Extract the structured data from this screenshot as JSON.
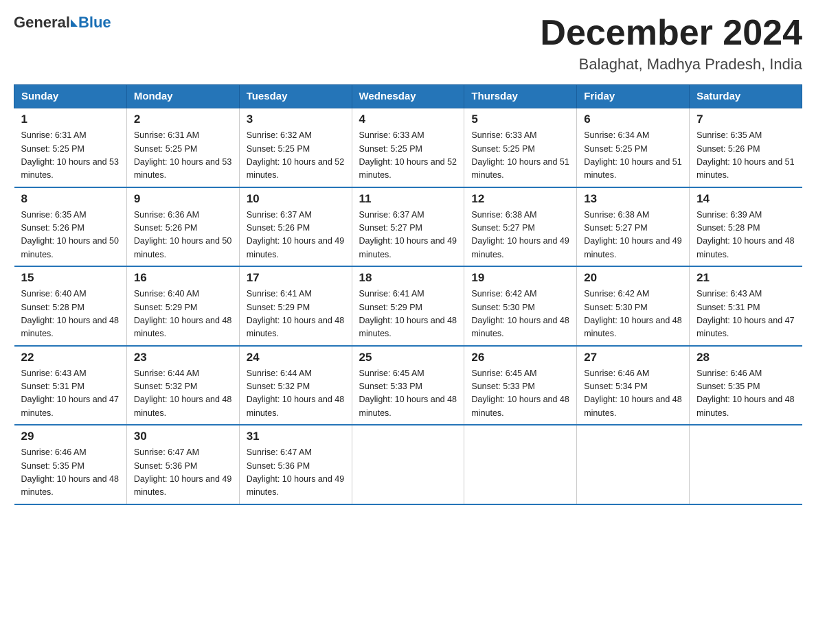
{
  "header": {
    "logo_general": "General",
    "logo_blue": "Blue",
    "month_title": "December 2024",
    "location": "Balaghat, Madhya Pradesh, India"
  },
  "days_of_week": [
    "Sunday",
    "Monday",
    "Tuesday",
    "Wednesday",
    "Thursday",
    "Friday",
    "Saturday"
  ],
  "weeks": [
    [
      {
        "day": "1",
        "sunrise": "6:31 AM",
        "sunset": "5:25 PM",
        "daylight": "10 hours and 53 minutes."
      },
      {
        "day": "2",
        "sunrise": "6:31 AM",
        "sunset": "5:25 PM",
        "daylight": "10 hours and 53 minutes."
      },
      {
        "day": "3",
        "sunrise": "6:32 AM",
        "sunset": "5:25 PM",
        "daylight": "10 hours and 52 minutes."
      },
      {
        "day": "4",
        "sunrise": "6:33 AM",
        "sunset": "5:25 PM",
        "daylight": "10 hours and 52 minutes."
      },
      {
        "day": "5",
        "sunrise": "6:33 AM",
        "sunset": "5:25 PM",
        "daylight": "10 hours and 51 minutes."
      },
      {
        "day": "6",
        "sunrise": "6:34 AM",
        "sunset": "5:25 PM",
        "daylight": "10 hours and 51 minutes."
      },
      {
        "day": "7",
        "sunrise": "6:35 AM",
        "sunset": "5:26 PM",
        "daylight": "10 hours and 51 minutes."
      }
    ],
    [
      {
        "day": "8",
        "sunrise": "6:35 AM",
        "sunset": "5:26 PM",
        "daylight": "10 hours and 50 minutes."
      },
      {
        "day": "9",
        "sunrise": "6:36 AM",
        "sunset": "5:26 PM",
        "daylight": "10 hours and 50 minutes."
      },
      {
        "day": "10",
        "sunrise": "6:37 AM",
        "sunset": "5:26 PM",
        "daylight": "10 hours and 49 minutes."
      },
      {
        "day": "11",
        "sunrise": "6:37 AM",
        "sunset": "5:27 PM",
        "daylight": "10 hours and 49 minutes."
      },
      {
        "day": "12",
        "sunrise": "6:38 AM",
        "sunset": "5:27 PM",
        "daylight": "10 hours and 49 minutes."
      },
      {
        "day": "13",
        "sunrise": "6:38 AM",
        "sunset": "5:27 PM",
        "daylight": "10 hours and 49 minutes."
      },
      {
        "day": "14",
        "sunrise": "6:39 AM",
        "sunset": "5:28 PM",
        "daylight": "10 hours and 48 minutes."
      }
    ],
    [
      {
        "day": "15",
        "sunrise": "6:40 AM",
        "sunset": "5:28 PM",
        "daylight": "10 hours and 48 minutes."
      },
      {
        "day": "16",
        "sunrise": "6:40 AM",
        "sunset": "5:29 PM",
        "daylight": "10 hours and 48 minutes."
      },
      {
        "day": "17",
        "sunrise": "6:41 AM",
        "sunset": "5:29 PM",
        "daylight": "10 hours and 48 minutes."
      },
      {
        "day": "18",
        "sunrise": "6:41 AM",
        "sunset": "5:29 PM",
        "daylight": "10 hours and 48 minutes."
      },
      {
        "day": "19",
        "sunrise": "6:42 AM",
        "sunset": "5:30 PM",
        "daylight": "10 hours and 48 minutes."
      },
      {
        "day": "20",
        "sunrise": "6:42 AM",
        "sunset": "5:30 PM",
        "daylight": "10 hours and 48 minutes."
      },
      {
        "day": "21",
        "sunrise": "6:43 AM",
        "sunset": "5:31 PM",
        "daylight": "10 hours and 47 minutes."
      }
    ],
    [
      {
        "day": "22",
        "sunrise": "6:43 AM",
        "sunset": "5:31 PM",
        "daylight": "10 hours and 47 minutes."
      },
      {
        "day": "23",
        "sunrise": "6:44 AM",
        "sunset": "5:32 PM",
        "daylight": "10 hours and 48 minutes."
      },
      {
        "day": "24",
        "sunrise": "6:44 AM",
        "sunset": "5:32 PM",
        "daylight": "10 hours and 48 minutes."
      },
      {
        "day": "25",
        "sunrise": "6:45 AM",
        "sunset": "5:33 PM",
        "daylight": "10 hours and 48 minutes."
      },
      {
        "day": "26",
        "sunrise": "6:45 AM",
        "sunset": "5:33 PM",
        "daylight": "10 hours and 48 minutes."
      },
      {
        "day": "27",
        "sunrise": "6:46 AM",
        "sunset": "5:34 PM",
        "daylight": "10 hours and 48 minutes."
      },
      {
        "day": "28",
        "sunrise": "6:46 AM",
        "sunset": "5:35 PM",
        "daylight": "10 hours and 48 minutes."
      }
    ],
    [
      {
        "day": "29",
        "sunrise": "6:46 AM",
        "sunset": "5:35 PM",
        "daylight": "10 hours and 48 minutes."
      },
      {
        "day": "30",
        "sunrise": "6:47 AM",
        "sunset": "5:36 PM",
        "daylight": "10 hours and 49 minutes."
      },
      {
        "day": "31",
        "sunrise": "6:47 AM",
        "sunset": "5:36 PM",
        "daylight": "10 hours and 49 minutes."
      },
      null,
      null,
      null,
      null
    ]
  ]
}
